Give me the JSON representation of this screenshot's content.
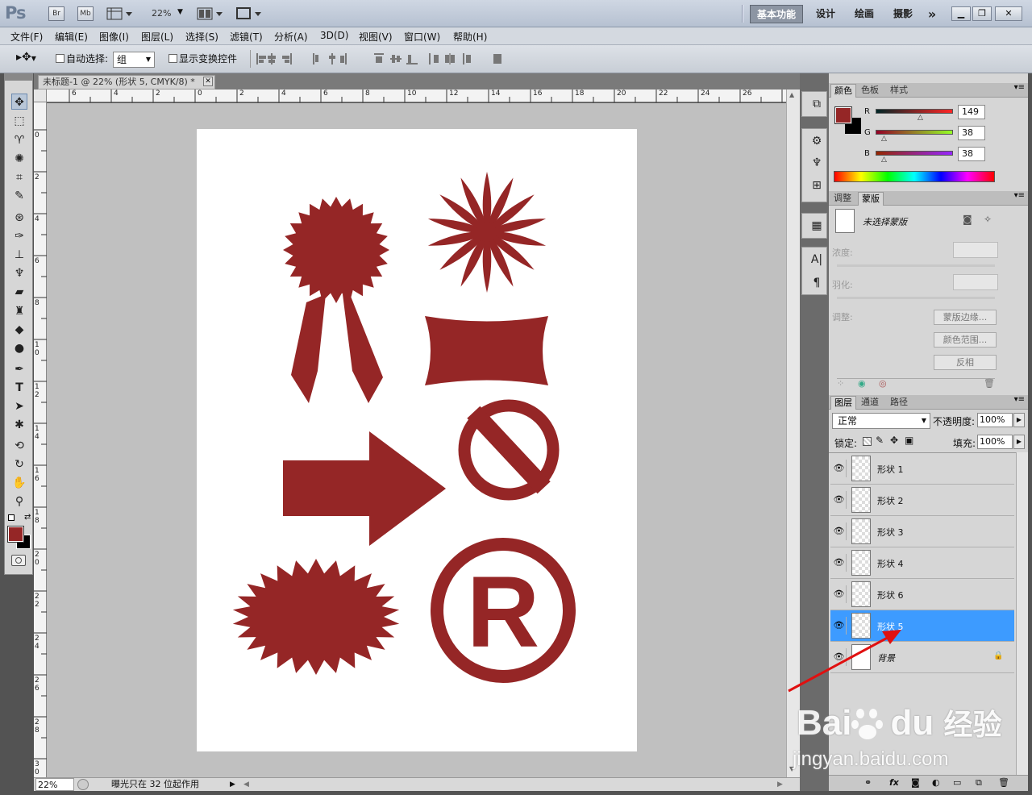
{
  "app": {
    "logo": "Ps",
    "bridge_label": "Br",
    "minibridge_label": "Mb",
    "zoom": "22%",
    "workspaces": [
      "基本功能",
      "设计",
      "绘画",
      "摄影"
    ],
    "more": "»"
  },
  "menu": [
    "文件(F)",
    "编辑(E)",
    "图像(I)",
    "图层(L)",
    "选择(S)",
    "滤镜(T)",
    "分析(A)",
    "3D(D)",
    "视图(V)",
    "窗口(W)",
    "帮助(H)"
  ],
  "options": {
    "auto_select_label": "自动选择:",
    "auto_select_value": "组",
    "show_transform_label": "显示变换控件"
  },
  "document": {
    "tab_title": "未标题-1 @ 22% (形状 5, CMYK/8) *",
    "h_ticks": [
      "6",
      "4",
      "2",
      "0",
      "2",
      "4",
      "6",
      "8",
      "10",
      "12",
      "14",
      "16",
      "18",
      "20",
      "22",
      "24",
      "26"
    ],
    "v_ticks": [
      "0",
      "2",
      "4",
      "6",
      "8",
      "1 0",
      "1 2",
      "1 4",
      "1 6",
      "1 8",
      "2 0",
      "2 2",
      "2 4",
      "2 6",
      "2 8",
      "3 0"
    ],
    "status_zoom": "22%",
    "status_text": "曝光只在 32 位起作用"
  },
  "color_panel": {
    "tabs": [
      "颜色",
      "色板",
      "样式"
    ],
    "r_label": "R",
    "g_label": "G",
    "b_label": "B",
    "r": "149",
    "g": "38",
    "b": "38",
    "fg_color": "#952626"
  },
  "adjust_panel": {
    "tabs": [
      "调整",
      "蒙版"
    ],
    "mask_title": "未选择蒙版",
    "density_label": "浓度:",
    "feather_label": "羽化:",
    "refine_label": "调整:",
    "mask_edge": "蒙版边缘...",
    "color_range": "颜色范围...",
    "invert": "反相"
  },
  "layers_panel": {
    "tabs": [
      "图层",
      "通道",
      "路径"
    ],
    "blend_mode": "正常",
    "opacity_label": "不透明度:",
    "opacity": "100%",
    "lock_label": "锁定:",
    "fill_label": "填充:",
    "fill": "100%",
    "layers": [
      {
        "name": "形状 1",
        "selected": false
      },
      {
        "name": "形状 2",
        "selected": false
      },
      {
        "name": "形状 3",
        "selected": false
      },
      {
        "name": "形状 4",
        "selected": false
      },
      {
        "name": "形状 6",
        "selected": false
      },
      {
        "name": "形状 5",
        "selected": true
      },
      {
        "name": "背景",
        "selected": false
      }
    ],
    "footer_fx": "fx"
  },
  "watermark": {
    "brand": "Bai",
    "brand2": "du",
    "cn": "经验",
    "url": "jingyan.baidu.com"
  },
  "shape_color": "#952626"
}
